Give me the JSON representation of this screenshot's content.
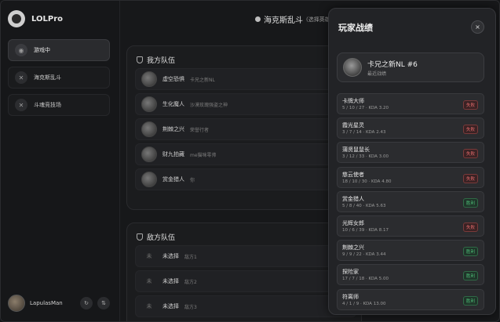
{
  "app": {
    "title": "LOLPro"
  },
  "sidebar": {
    "items": [
      {
        "label": "游戏中",
        "icon": "gamepad-icon",
        "active": true
      },
      {
        "label": "海克斯乱斗",
        "icon": "cross-swords-icon",
        "active": false
      },
      {
        "label": "斗魂竞技场",
        "icon": "cross-swords-icon",
        "active": false
      }
    ],
    "profile": {
      "name": "LapulasMan"
    }
  },
  "header": {
    "mode": "海克斯乱斗",
    "mode_sub": "(选择英雄"
  },
  "our_team": {
    "title": "我方队伍",
    "players": [
      {
        "name": "虚空恐惧",
        "title": "卡兄之新NL"
      },
      {
        "name": "生化魔人",
        "title": "沙漠玫瑰强盗之神"
      },
      {
        "name": "荆棘之兴",
        "title": "荣誉行者"
      },
      {
        "name": "财九拍藏",
        "title": "me猫咪零帅"
      },
      {
        "name": "赏金猎人",
        "title": "你"
      }
    ]
  },
  "enemy_team": {
    "title": "敌方队伍",
    "players": [
      {
        "slot": "未",
        "name": "未选择",
        "title": "敌方1"
      },
      {
        "slot": "未",
        "name": "未选择",
        "title": "敌方2"
      },
      {
        "slot": "未",
        "name": "未选择",
        "title": "敌方3"
      }
    ]
  },
  "overlay": {
    "title": "玩家战绩",
    "close_label": "×",
    "player": {
      "name": "卡兄之新NL #6",
      "sub": "最近战绩"
    },
    "matches": [
      {
        "champion": "卡牌大师",
        "stats": "5 / 10 / 27 · KDA 3.20",
        "result": "失败",
        "win": false
      },
      {
        "champion": "霞光星灵",
        "stats": "3 / 7 / 14 · KDA 2.43",
        "result": "失败",
        "win": false
      },
      {
        "champion": "蒲贤鼠鼠长",
        "stats": "3 / 12 / 33 · KDA 3.00",
        "result": "失败",
        "win": false
      },
      {
        "champion": "慈云使者",
        "stats": "18 / 10 / 30 · KDA 4.80",
        "result": "失败",
        "win": false
      },
      {
        "champion": "赏金猎人",
        "stats": "5 / 8 / 40 · KDA 5.63",
        "result": "胜利",
        "win": true
      },
      {
        "champion": "光辉女郎",
        "stats": "10 / 6 / 39 · KDA 8.17",
        "result": "失败",
        "win": false
      },
      {
        "champion": "荆棘之兴",
        "stats": "9 / 9 / 22 · KDA 3.44",
        "result": "胜利",
        "win": true
      },
      {
        "champion": "探险家",
        "stats": "17 / 7 / 18 · KDA 5.00",
        "result": "胜利",
        "win": true
      },
      {
        "champion": "符离师",
        "stats": "4 / 1 / 9 · KDA 13.00",
        "result": "胜利",
        "win": true
      }
    ]
  },
  "colors": {
    "win": "#4fc27a",
    "loss": "#e06a6a",
    "background": "#17181a"
  }
}
